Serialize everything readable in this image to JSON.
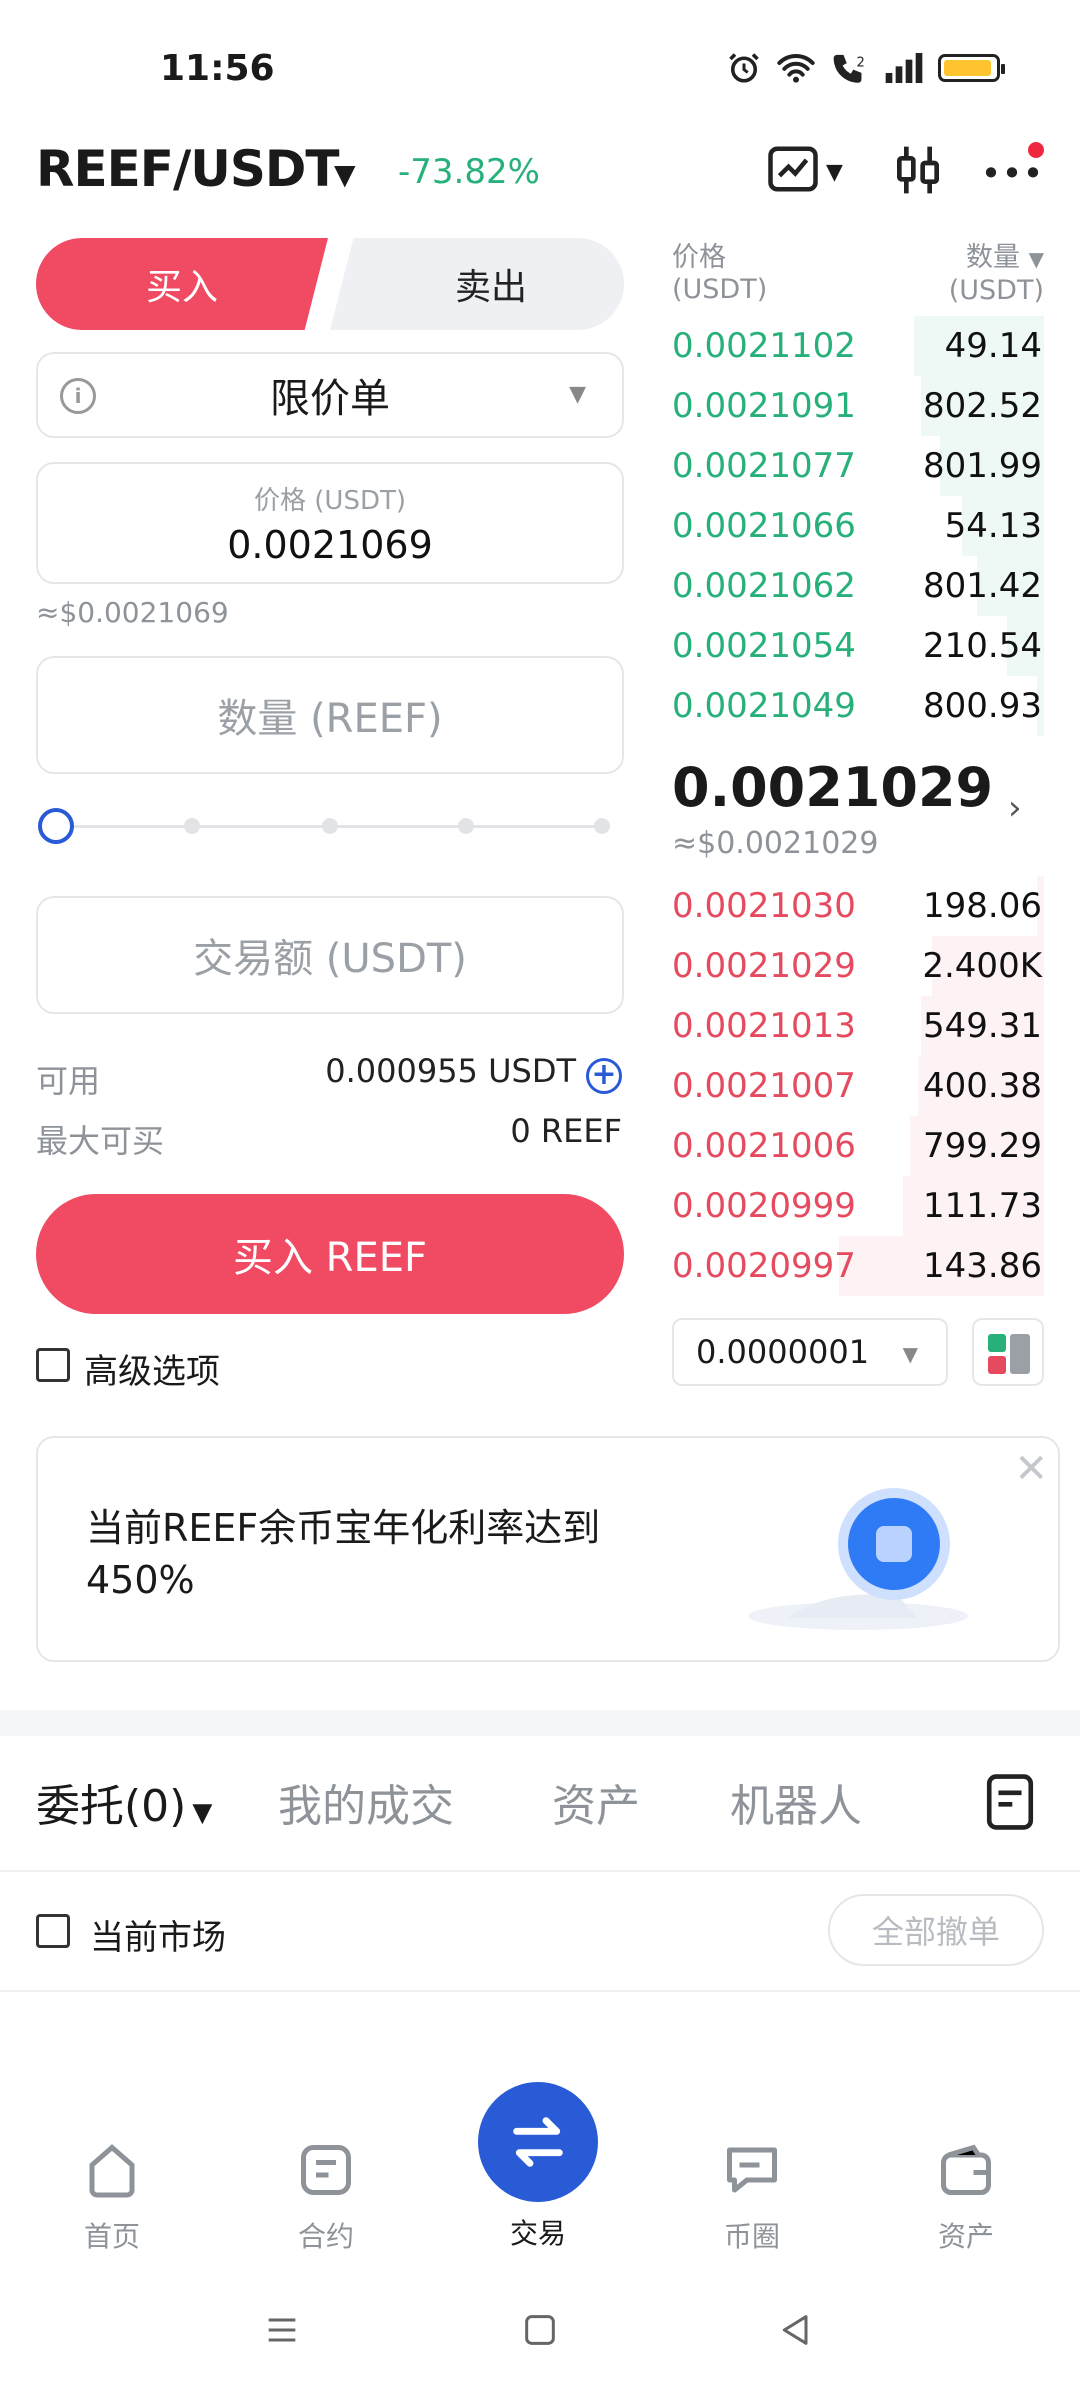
{
  "status_bar": {
    "time": "11:56"
  },
  "header": {
    "pair": "REEF/USDT",
    "change": "-73.82%"
  },
  "trade_tabs": {
    "buy": "买入",
    "sell": "卖出"
  },
  "order_type": {
    "selected": "限价单",
    "info_icon": "i"
  },
  "price_input": {
    "label": "价格 (USDT)",
    "value": "0.0021069",
    "usd_approx": "≈$0.0021069"
  },
  "quantity_input": {
    "placeholder": "数量 (REEF)"
  },
  "amount_input": {
    "placeholder": "交易额 (USDT)"
  },
  "available": {
    "label": "可用",
    "value": "0.000955 USDT"
  },
  "max_buy": {
    "label": "最大可买",
    "value": "0 REEF"
  },
  "buy_button": "买入 REEF",
  "advanced_option": "高级选项",
  "order_book": {
    "price_header": "价格",
    "price_unit": "(USDT)",
    "qty_header": "数量",
    "qty_unit": "(USDT)",
    "asks": [
      {
        "price": "0.0021102",
        "qty": "49.14",
        "depth": 0.35
      },
      {
        "price": "0.0021091",
        "qty": "802.52",
        "depth": 0.33
      },
      {
        "price": "0.0021077",
        "qty": "801.99",
        "depth": 0.28
      },
      {
        "price": "0.0021066",
        "qty": "54.13",
        "depth": 0.22
      },
      {
        "price": "0.0021062",
        "qty": "801.42",
        "depth": 0.18
      },
      {
        "price": "0.0021054",
        "qty": "210.54",
        "depth": 0.1
      },
      {
        "price": "0.0021049",
        "qty": "800.93",
        "depth": 0.02
      }
    ],
    "mid_price": "0.0021029",
    "mid_usd": "≈$0.0021029",
    "bids": [
      {
        "price": "0.0021030",
        "qty": "198.06",
        "depth": 0.02
      },
      {
        "price": "0.0021029",
        "qty": "2.400K",
        "depth": 0.3
      },
      {
        "price": "0.0021013",
        "qty": "549.31",
        "depth": 0.33
      },
      {
        "price": "0.0021007",
        "qty": "400.38",
        "depth": 0.34
      },
      {
        "price": "0.0021006",
        "qty": "799.29",
        "depth": 0.36
      },
      {
        "price": "0.0020999",
        "qty": "111.73",
        "depth": 0.38
      },
      {
        "price": "0.0020997",
        "qty": "143.86",
        "depth": 0.55
      }
    ],
    "depth_step": "0.0000001"
  },
  "banner": {
    "text": "当前REEF余币宝年化利率达到450%"
  },
  "section_tabs": {
    "orders": "委托(0)",
    "my_trades": "我的成交",
    "assets": "资产",
    "robots": "机器人"
  },
  "filter": {
    "current_market": "当前市场",
    "cancel_all": "全部撤单"
  },
  "bottom_nav": {
    "home": "首页",
    "contract": "合约",
    "trade": "交易",
    "community": "币圈",
    "assets": "资产"
  },
  "colors": {
    "accent_red": "#f04b63",
    "green": "#27b07a",
    "blue": "#2a5bd7"
  }
}
